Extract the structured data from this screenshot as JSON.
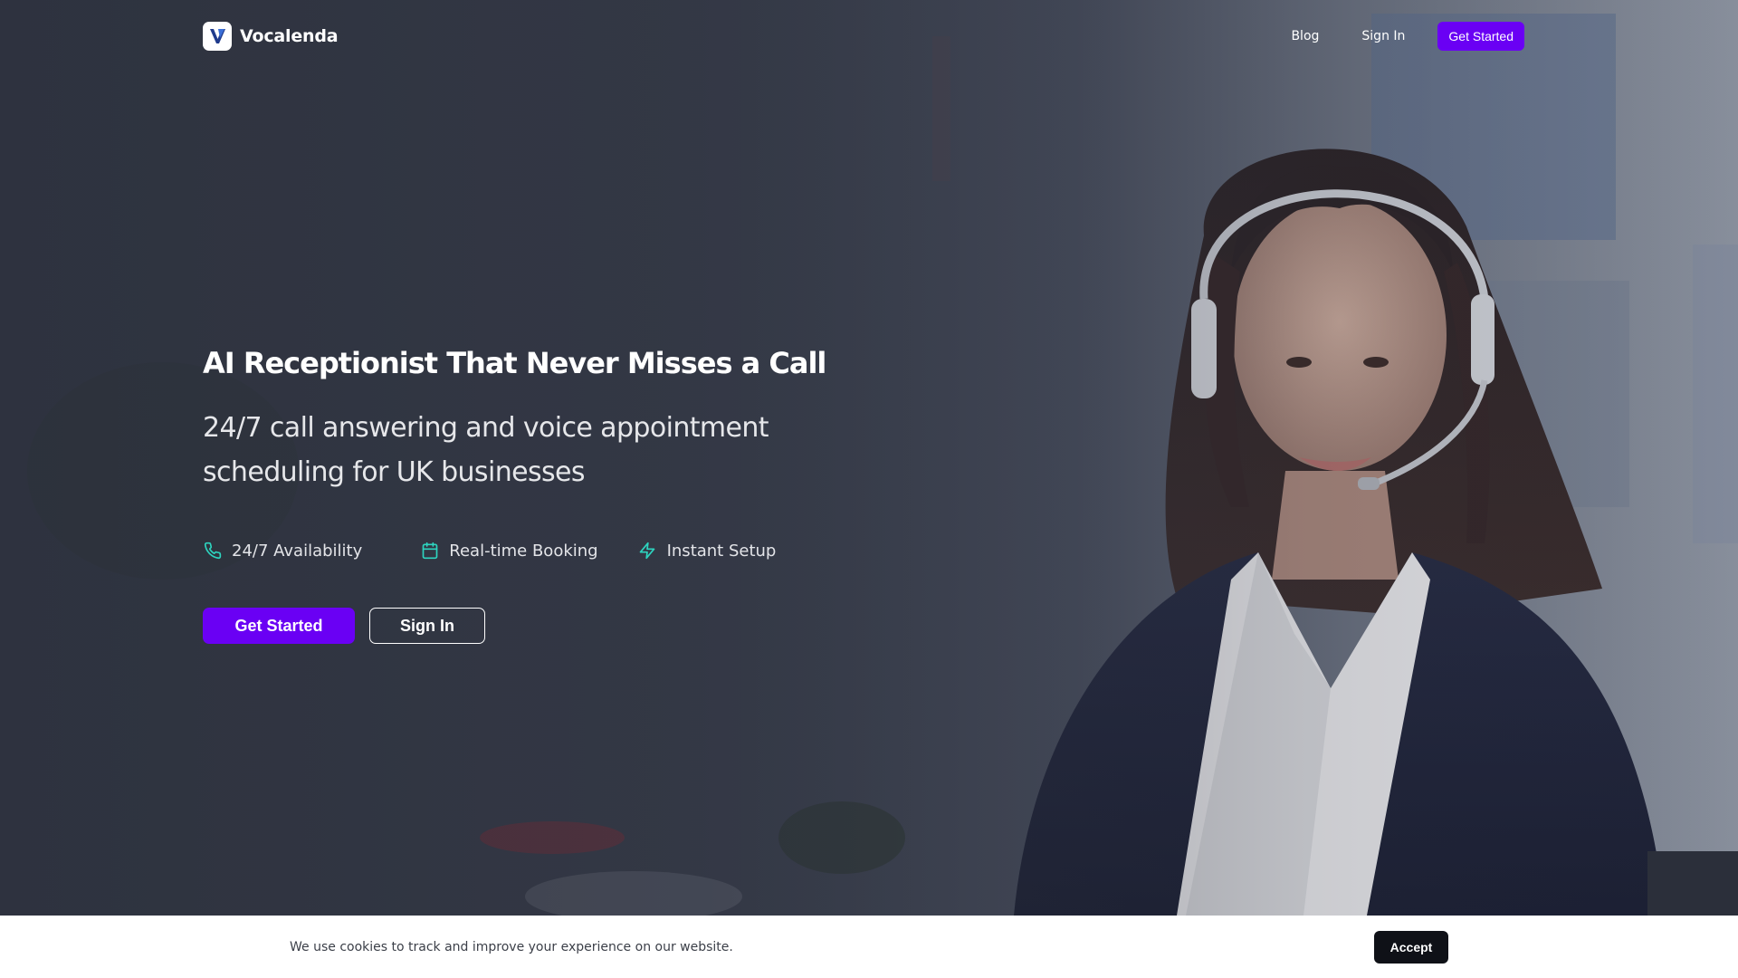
{
  "brand": {
    "name": "Vocalenda",
    "logo_icon": "v-logo-icon"
  },
  "nav": {
    "blog": "Blog",
    "sign_in": "Sign In",
    "get_started": "Get Started"
  },
  "hero": {
    "headline": "AI Receptionist That Never Misses a Call",
    "subheadline": "24/7 call answering and voice appointment scheduling for UK businesses",
    "features": [
      {
        "icon": "phone-icon",
        "label": "24/7 Availability"
      },
      {
        "icon": "calendar-icon",
        "label": "Real-time Booking"
      },
      {
        "icon": "lightning-icon",
        "label": "Instant Setup"
      }
    ],
    "primary_cta": "Get Started",
    "secondary_cta": "Sign In"
  },
  "cookie": {
    "message": "We use cookies to track and improve your experience on our website.",
    "accept": "Accept"
  },
  "colors": {
    "accent": "#6a00f4",
    "feature_icon": "#2dd4bf",
    "cookie_button": "#0f1117"
  }
}
